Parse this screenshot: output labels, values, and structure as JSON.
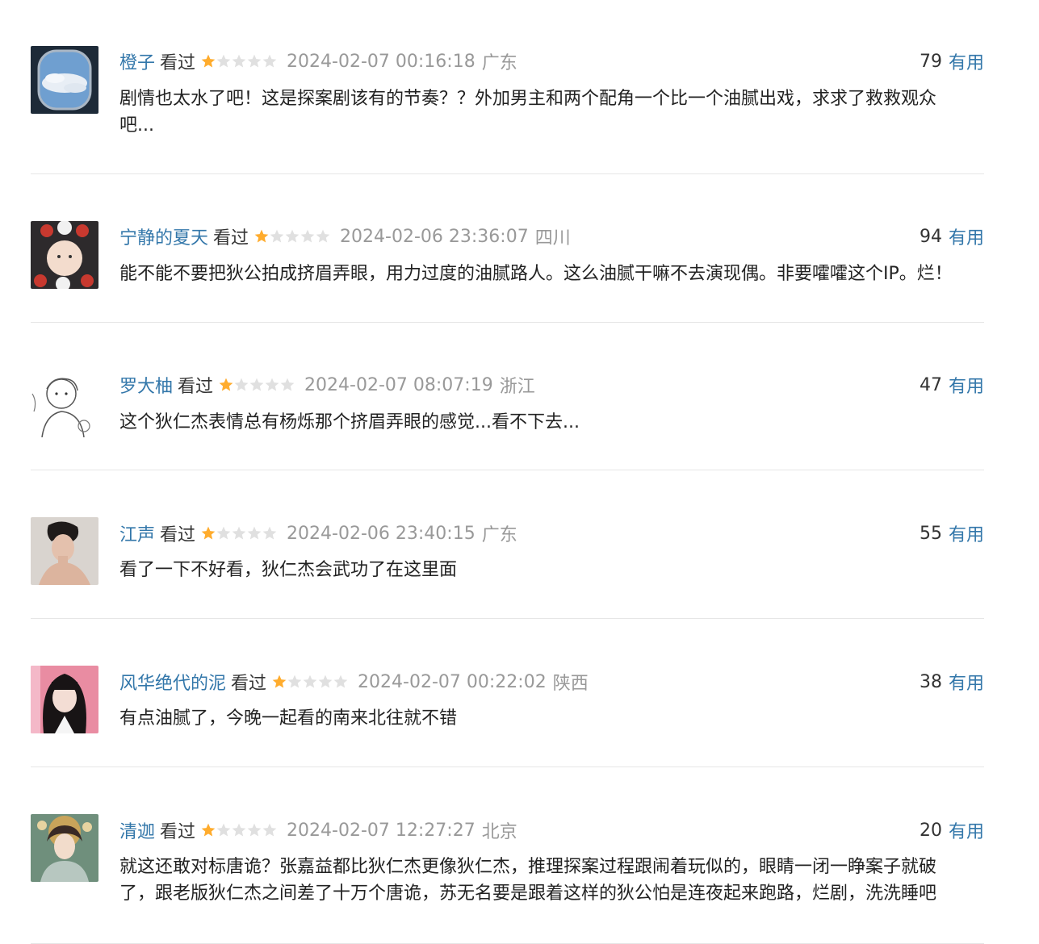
{
  "accent_color": "#3377aa",
  "star_color": "#ffac2d",
  "comments": [
    {
      "user": "橙子",
      "status": "看过",
      "rating": 1,
      "time": "2024-02-07 00:16:18",
      "location": "广东",
      "votes": "79",
      "useful_label": "有用",
      "avatar_icon": "sky-airplane-window-avatar",
      "text": "剧情也太水了吧！这是探案剧该有的节奏？？外加男主和两个配角一个比一个油腻出戏，求求了救救观众吧..."
    },
    {
      "user": "宁静的夏天",
      "status": "看过",
      "rating": 1,
      "time": "2024-02-06 23:36:07",
      "location": "四川",
      "votes": "94",
      "useful_label": "有用",
      "avatar_icon": "flower-crown-girl-avatar",
      "text": "能不能不要把狄公拍成挤眉弄眼，用力过度的油腻路人。这么油腻干嘛不去演现偶。非要嚯嚯这个IP。烂！"
    },
    {
      "user": "罗大柚",
      "status": "看过",
      "rating": 1,
      "time": "2024-02-07 08:07:19",
      "location": "浙江",
      "votes": "47",
      "useful_label": "有用",
      "avatar_icon": "sketch-boy-avatar",
      "text": "这个狄仁杰表情总有杨烁那个挤眉弄眼的感觉...看不下去..."
    },
    {
      "user": "江声",
      "status": "看过",
      "rating": 1,
      "time": "2024-02-06 23:40:15",
      "location": "广东",
      "votes": "55",
      "useful_label": "有用",
      "avatar_icon": "portrait-photo-avatar",
      "text": "看了一下不好看，狄仁杰会武功了在这里面"
    },
    {
      "user": "风华绝代的泥",
      "status": "看过",
      "rating": 1,
      "time": "2024-02-07 00:22:02",
      "location": "陕西",
      "votes": "38",
      "useful_label": "有用",
      "avatar_icon": "dark-hair-girl-avatar",
      "text": "有点油腻了，今晚一起看的南来北往就不错"
    },
    {
      "user": "清迦",
      "status": "看过",
      "rating": 1,
      "time": "2024-02-07 12:27:27",
      "location": "北京",
      "votes": "20",
      "useful_label": "有用",
      "avatar_icon": "illustrated-girl-avatar",
      "text": "就这还敢对标唐诡？张嘉益都比狄仁杰更像狄仁杰，推理探案过程跟闹着玩似的，眼睛一闭一睁案子就破了，跟老版狄仁杰之间差了十万个唐诡，苏无名要是跟着这样的狄公怕是连夜起来跑路，烂剧，洗洗睡吧"
    }
  ]
}
